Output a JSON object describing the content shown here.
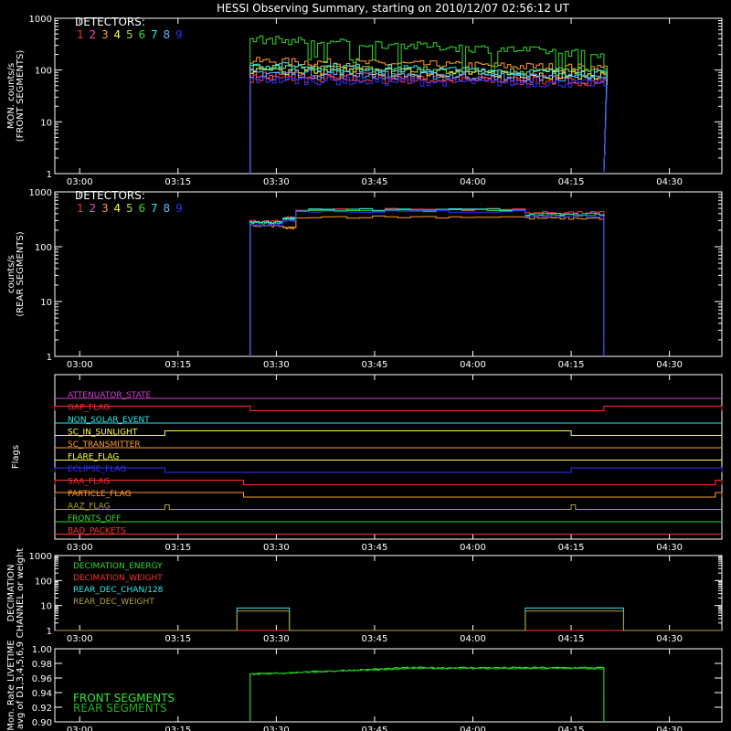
{
  "title": "HESSI Observing Summary, starting on 2010/12/07 02:56:12 UT",
  "colors": {
    "d1": "#ff3030",
    "d2": "#ff4aa8",
    "d3": "#ff9a30",
    "d4": "#ffff40",
    "d5": "#a8d848",
    "d6": "#30d830",
    "d7": "#30e8e8",
    "d8": "#5ab4ff",
    "d9": "#3030ff"
  },
  "time_axis": {
    "start": "02:56:12",
    "range": [
      "02:56:12",
      "04:38:00"
    ],
    "ticks": [
      "03:00",
      "03:15",
      "03:30",
      "03:45",
      "04:00",
      "04:15",
      "04:30"
    ]
  },
  "chart_data": [
    {
      "type": "line",
      "ylabel_lines": [
        "MON. counts/s",
        "(FRONT SEGMENTS)"
      ],
      "yscale": "log",
      "ylim": [
        1,
        1000
      ],
      "yticks": [
        "1",
        "10",
        "100",
        "1000"
      ],
      "legend": {
        "title": "DETECTORS:",
        "labels": [
          "1",
          "2",
          "3",
          "4",
          "5",
          "6",
          "7",
          "8",
          "9"
        ],
        "placement": "top-left"
      },
      "x_range_data": [
        "03:26:00",
        "04:20:00"
      ],
      "series": [
        {
          "name": "1",
          "start": 70,
          "end": 60
        },
        {
          "name": "2",
          "start": 80,
          "end": 65
        },
        {
          "name": "3",
          "start": 150,
          "end": 110
        },
        {
          "name": "4",
          "start": 100,
          "end": 80
        },
        {
          "name": "5",
          "start": 110,
          "end": 90
        },
        {
          "name": "6",
          "start": 400,
          "end": 210
        },
        {
          "name": "7",
          "start": 125,
          "end": 85
        },
        {
          "name": "8",
          "start": 90,
          "end": 70
        },
        {
          "name": "9",
          "start": 65,
          "end": 55
        }
      ]
    },
    {
      "type": "line",
      "ylabel_lines": [
        "counts/s",
        "(REAR SEGMENTS)"
      ],
      "yscale": "log",
      "ylim": [
        1,
        1000
      ],
      "yticks": [
        "1",
        "10",
        "100",
        "1000"
      ],
      "legend": {
        "title": "DETECTORS:",
        "labels": [
          "1",
          "2",
          "3",
          "4",
          "5",
          "6",
          "7",
          "8",
          "9"
        ],
        "placement": "top-left"
      },
      "x_range_data": [
        "03:26:00",
        "04:20:00"
      ],
      "steps": [
        "03:26:00",
        "03:31:00",
        "03:33:00",
        "04:08:00",
        "04:20:00"
      ],
      "series": [
        {
          "name": "1",
          "levels": [
            290,
            340,
            480,
            420,
            210
          ]
        },
        {
          "name": "3",
          "levels": [
            240,
            220,
            350,
            330,
            170
          ]
        },
        {
          "name": "6",
          "levels": [
            270,
            320,
            460,
            380,
            180
          ]
        },
        {
          "name": "7",
          "levels": [
            280,
            330,
            470,
            390,
            175
          ]
        },
        {
          "name": "9",
          "levels": [
            250,
            300,
            440,
            360,
            160
          ]
        }
      ]
    },
    {
      "type": "line",
      "ylabel": "Flags",
      "flags": [
        {
          "label": "ATTENUATOR_STATE",
          "color": "#d040d0",
          "on": []
        },
        {
          "label": "GAP_FLAG",
          "color": "#ff3030",
          "on": [
            [
              "02:56:12",
              "03:26:00"
            ],
            [
              "04:20:00",
              "04:38:00"
            ]
          ]
        },
        {
          "label": "NON_SOLAR_EVENT",
          "color": "#30e8e8",
          "on": []
        },
        {
          "label": "SC_IN_SUNLIGHT",
          "color": "#ffff40",
          "on": [
            [
              "03:13:00",
              "04:15:00"
            ]
          ]
        },
        {
          "label": "SC_TRANSMITTER",
          "color": "#ff9a30",
          "on": []
        },
        {
          "label": "FLARE_FLAG",
          "color": "#ffff40",
          "on": []
        },
        {
          "label": "ECLIPSE_FLAG",
          "color": "#3030ff",
          "on": [
            [
              "02:56:12",
              "03:13:00"
            ],
            [
              "04:15:00",
              "04:38:00"
            ]
          ]
        },
        {
          "label": "SAA_FLAG",
          "color": "#ff3030",
          "on": [
            [
              "02:56:12",
              "03:25:00"
            ],
            [
              "04:37:00",
              "04:38:00"
            ]
          ]
        },
        {
          "label": "PARTICLE_FLAG",
          "color": "#ff9a30",
          "on": [
            [
              "02:56:12",
              "03:25:00"
            ],
            [
              "04:37:00",
              "04:38:00"
            ]
          ]
        },
        {
          "label": "AAZ_FLAG",
          "color": "#b0a040",
          "on": [
            [
              "03:13:00",
              "03:13:40"
            ],
            [
              "04:15:00",
              "04:15:40"
            ]
          ]
        },
        {
          "label": "FRONTS_OFF",
          "color": "#30d830",
          "on": []
        },
        {
          "label": "BAD_PACKETS",
          "color": "#ff3030",
          "on": []
        }
      ]
    },
    {
      "type": "line",
      "ylabel_lines": [
        "DECIMATION",
        "CHANNEL or weight"
      ],
      "yscale": "log",
      "ylim": [
        1,
        1000
      ],
      "yticks": [
        "1",
        "10",
        "100",
        "1000"
      ],
      "legend": {
        "placement": "top-left"
      },
      "series": [
        {
          "name": "DECIMATION_ENERGY",
          "color": "#30d830",
          "segments": [
            [
              "02:56:12",
              "04:38:00",
              1
            ]
          ]
        },
        {
          "name": "DECIMATION_WEIGHT",
          "color": "#ff3030",
          "segments": [
            [
              "02:56:12",
              "04:38:00",
              1
            ]
          ]
        },
        {
          "name": "REAR_DEC_CHAN/128",
          "color": "#30e8e8",
          "segments": [
            [
              "02:56:12",
              "03:24:00",
              1
            ],
            [
              "03:24:00",
              "03:32:00",
              8
            ],
            [
              "03:32:00",
              "04:08:00",
              1
            ],
            [
              "04:08:00",
              "04:23:00",
              8
            ],
            [
              "04:23:00",
              "04:38:00",
              1
            ]
          ]
        },
        {
          "name": "REAR_DEC_WEIGHT",
          "color": "#b0a040",
          "segments": [
            [
              "02:56:12",
              "03:24:00",
              1
            ],
            [
              "03:24:00",
              "03:32:00",
              6
            ],
            [
              "03:32:00",
              "04:08:00",
              1
            ],
            [
              "04:08:00",
              "04:23:00",
              6
            ],
            [
              "04:23:00",
              "04:38:00",
              1
            ]
          ]
        }
      ]
    },
    {
      "type": "line",
      "ylabel_lines": [
        "Mon. Rate LIVETIME",
        "avg of D1,3,4,5,6,9"
      ],
      "ylim": [
        0.9,
        1.0
      ],
      "yticks": [
        "0.90",
        "0.92",
        "0.94",
        "0.96",
        "0.98",
        "1.00"
      ],
      "legend": {
        "placement": "bottom-left"
      },
      "series": [
        {
          "name": "FRONT SEGMENTS",
          "color": "#30e830",
          "x_range": [
            "03:26:00",
            "04:20:00"
          ],
          "start": 0.965,
          "end": 0.974
        },
        {
          "name": "REAR SEGMENTS",
          "color": "#20b020",
          "x_range": [
            "03:26:00",
            "04:20:00"
          ],
          "start": 0.965,
          "end": 0.973
        }
      ]
    }
  ]
}
